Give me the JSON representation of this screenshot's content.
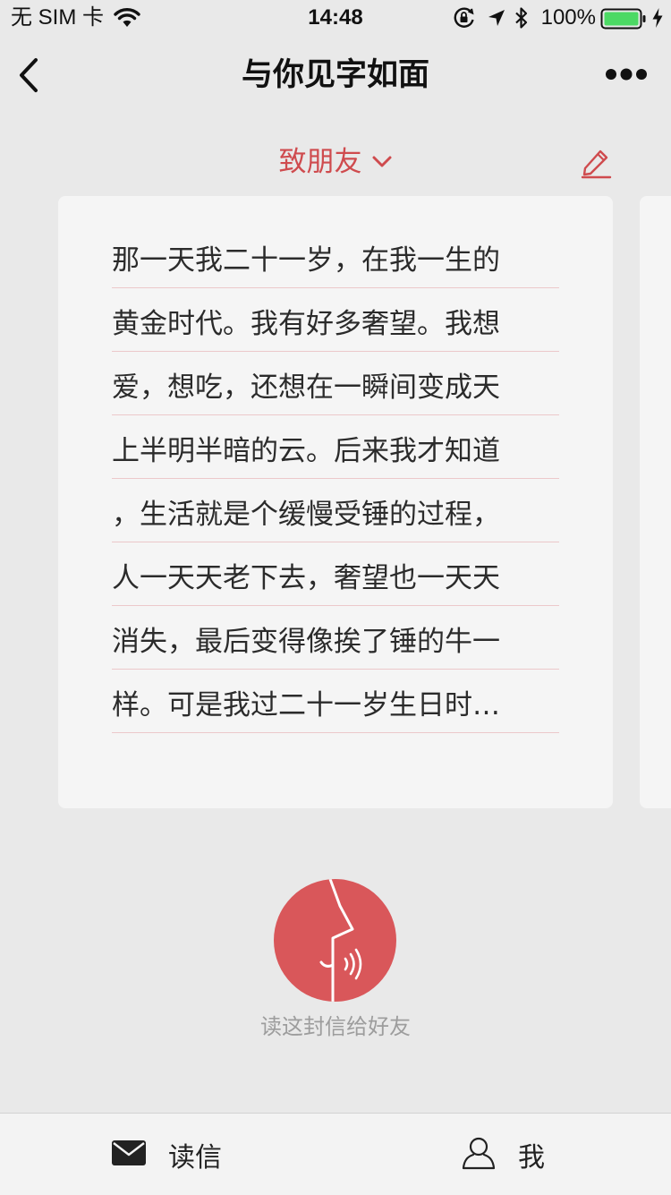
{
  "status_bar": {
    "carrier": "无 SIM 卡",
    "time": "14:48",
    "battery_percent": "100%",
    "icons": [
      "wifi-icon",
      "orientation-lock-icon",
      "location-icon",
      "bluetooth-icon",
      "battery-icon",
      "charging-icon"
    ]
  },
  "nav": {
    "title": "与你见字如面",
    "back_icon": "chevron-left-icon",
    "more_icon": "more-icon"
  },
  "recipient": {
    "label": "致朋友",
    "dropdown_icon": "chevron-down-icon",
    "edit_icon": "pencil-icon"
  },
  "letter": {
    "lines": [
      "那一天我二十一岁，在我一生的",
      "黄金时代。我有好多奢望。我想",
      "爱，想吃，还想在一瞬间变成天",
      "上半明半暗的云。后来我才知道",
      "，生活就是个缓慢受锤的过程，",
      "人一天天老下去，奢望也一天天",
      "消失，最后变得像挨了锤的牛一",
      "样。可是我过二十一岁生日时…"
    ]
  },
  "voice": {
    "caption": "读这封信给好友",
    "icon": "speaking-face-icon"
  },
  "tabs": [
    {
      "label": "读信",
      "icon": "envelope-icon"
    },
    {
      "label": "我",
      "icon": "person-icon"
    }
  ],
  "colors": {
    "accent": "#d9575a",
    "accent_text": "#cf4b4e",
    "background": "#e9e9e9",
    "card": "#f5f5f5",
    "line_divider": "#ecc8ca"
  }
}
